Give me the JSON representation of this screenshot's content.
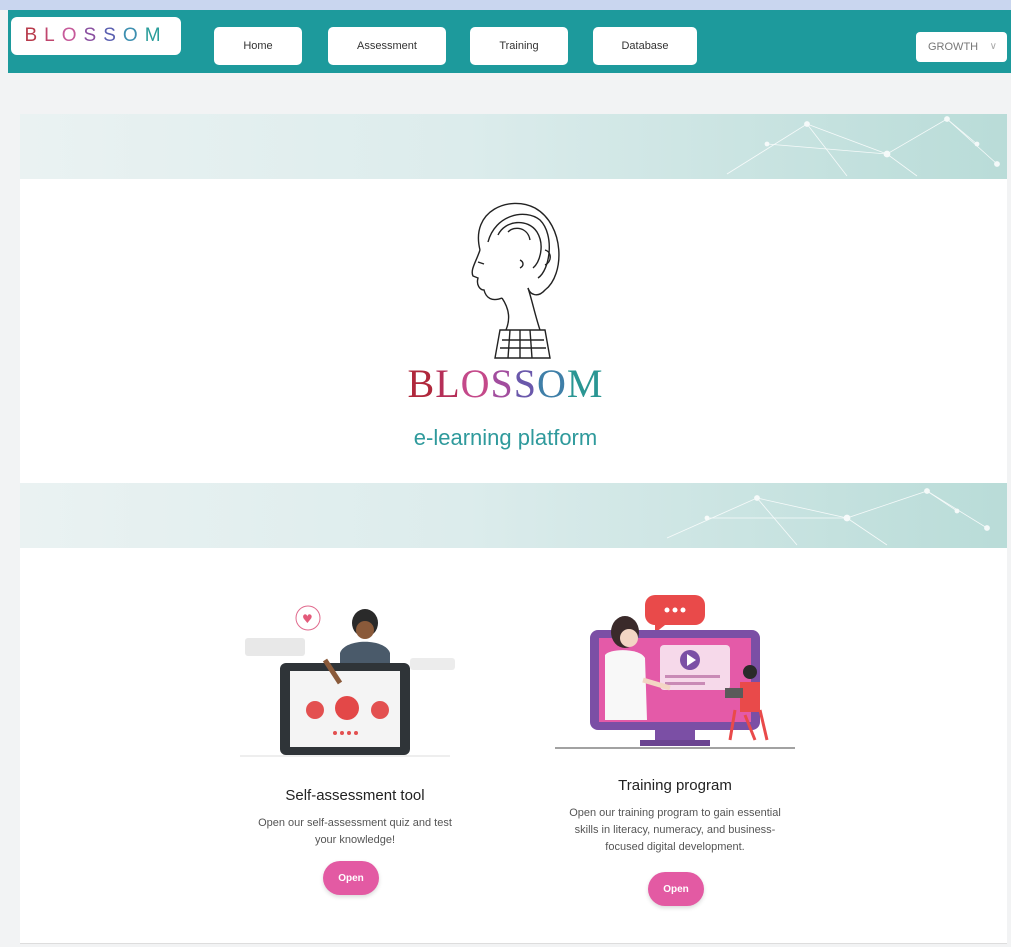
{
  "nav": {
    "brand": [
      "B",
      "L",
      "O",
      "S",
      "S",
      "O",
      "M"
    ],
    "brand_colors": [
      "#b83a4b",
      "#c0466e",
      "#c65a9a",
      "#8a4fa0",
      "#5a5fb0",
      "#3d8fb0",
      "#2a9d9a"
    ],
    "items": [
      {
        "label": "Home"
      },
      {
        "label": "Assessment"
      },
      {
        "label": "Training"
      },
      {
        "label": "Database"
      }
    ],
    "language_selector": "GROWTH"
  },
  "hero": {
    "wordmark": [
      "B",
      "L",
      "O",
      "S",
      "S",
      "O",
      "M"
    ],
    "wordmark_colors": [
      "#b0283c",
      "#b52f58",
      "#c4498a",
      "#a24d9e",
      "#6a58ab",
      "#3f7fa8",
      "#2a9693"
    ],
    "tagline": "e-learning platform"
  },
  "features": [
    {
      "title": "Self-assessment tool",
      "description_lines": [
        "Open our self-assessment quiz and test",
        "your knowledge!"
      ],
      "button": "Open"
    },
    {
      "title": "Training program",
      "description_lines": [
        "Open our training program to gain essential",
        "skills in literacy, numeracy, and business-",
        "focused digital development."
      ],
      "button": "Open"
    }
  ],
  "colors": {
    "teal": "#1d9a9c",
    "pink": "#e35aa3"
  }
}
